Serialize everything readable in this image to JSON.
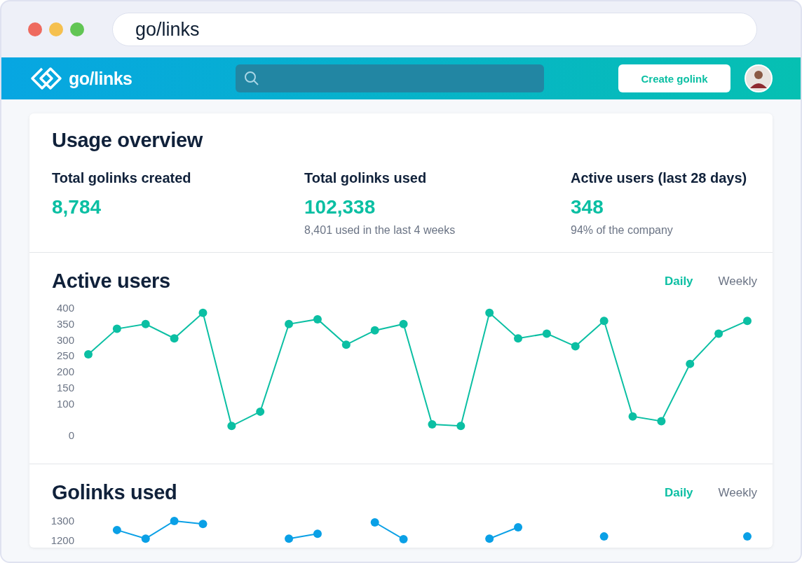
{
  "browser": {
    "address": "go/links"
  },
  "header": {
    "logo_text": "go/links",
    "create_button": "Create golink"
  },
  "overview": {
    "title": "Usage overview",
    "stats": [
      {
        "label": "Total golinks created",
        "value": "8,784"
      },
      {
        "label": "Total golinks used",
        "value": "102,338",
        "note": "8,401 used in the last 4 weeks"
      },
      {
        "label": "Active users (last 28 days)",
        "value": "348",
        "note": "94% of the company"
      }
    ]
  },
  "charts": [
    {
      "title": "Active users",
      "tabs": [
        {
          "label": "Daily",
          "selected": true
        },
        {
          "label": "Weekly",
          "selected": false
        }
      ],
      "chart_data": {
        "type": "line",
        "ylim": [
          0,
          400
        ],
        "yticks": [
          0,
          100,
          150,
          200,
          250,
          300,
          350,
          400
        ],
        "series": [
          {
            "color": "#0bbfa3",
            "marker": "circle",
            "values": [
              255,
              335,
              350,
              305,
              385,
              30,
              75,
              350,
              365,
              285,
              330,
              350,
              35,
              30,
              385,
              305,
              320,
              280,
              360,
              60,
              45,
              225,
              320,
              360
            ]
          }
        ]
      }
    },
    {
      "title": "Golinks used",
      "tabs": [
        {
          "label": "Daily",
          "selected": true
        },
        {
          "label": "Weekly",
          "selected": false
        }
      ],
      "chart_data": {
        "type": "line",
        "ylim": [
          1200,
          1300
        ],
        "yticks": [
          1200,
          1300
        ],
        "series": [
          {
            "color": "#0aa0e6",
            "marker": "circle",
            "values": [
              null,
              1254,
              1210,
              1300,
              1285,
              null,
              null,
              1210,
              1235,
              null,
              1293,
              1207,
              null,
              null,
              1210,
              1268,
              null,
              null,
              1221,
              null,
              null,
              null,
              null,
              1221
            ]
          }
        ]
      }
    }
  ]
}
